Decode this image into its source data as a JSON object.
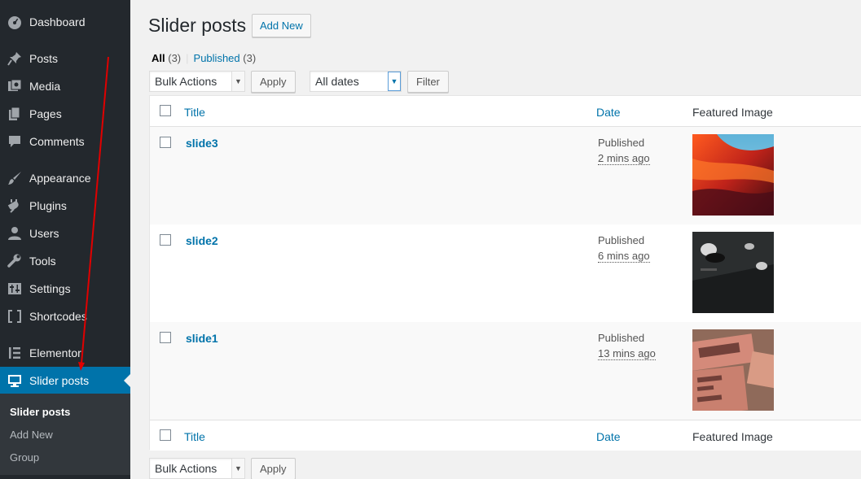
{
  "sidebar": {
    "items": [
      {
        "label": "Dashboard",
        "icon": "dashboard-icon"
      },
      {
        "label": "Posts",
        "icon": "pin-icon"
      },
      {
        "label": "Media",
        "icon": "media-icon"
      },
      {
        "label": "Pages",
        "icon": "pages-icon"
      },
      {
        "label": "Comments",
        "icon": "comment-icon"
      },
      {
        "label": "Appearance",
        "icon": "brush-icon"
      },
      {
        "label": "Plugins",
        "icon": "plugin-icon"
      },
      {
        "label": "Users",
        "icon": "user-icon"
      },
      {
        "label": "Tools",
        "icon": "wrench-icon"
      },
      {
        "label": "Settings",
        "icon": "settings-icon"
      },
      {
        "label": "Shortcodes",
        "icon": "shortcode-icon"
      },
      {
        "label": "Elementor",
        "icon": "elementor-icon"
      },
      {
        "label": "Slider posts",
        "icon": "monitor-icon"
      }
    ],
    "submenu": [
      "Slider posts",
      "Add New",
      "Group"
    ]
  },
  "header": {
    "title": "Slider posts",
    "add_new": "Add New"
  },
  "filters": {
    "all_label": "All",
    "all_count": "(3)",
    "separator": "|",
    "published_label": "Published",
    "published_count": "(3)",
    "bulk_actions": "Bulk Actions",
    "apply": "Apply",
    "all_dates": "All dates",
    "filter": "Filter"
  },
  "table": {
    "columns": [
      "Title",
      "Date",
      "Featured Image"
    ],
    "rows": [
      {
        "title": "slide3",
        "status": "Published",
        "time": "2 mins ago"
      },
      {
        "title": "slide2",
        "status": "Published",
        "time": "6 mins ago"
      },
      {
        "title": "slide1",
        "status": "Published",
        "time": "13 mins ago"
      }
    ]
  },
  "footer_actions": {
    "bulk_actions": "Bulk Actions",
    "apply": "Apply"
  },
  "colors": {
    "sidebar_bg": "#23282d",
    "accent": "#0073aa",
    "annotation_arrow": "#e00000"
  }
}
